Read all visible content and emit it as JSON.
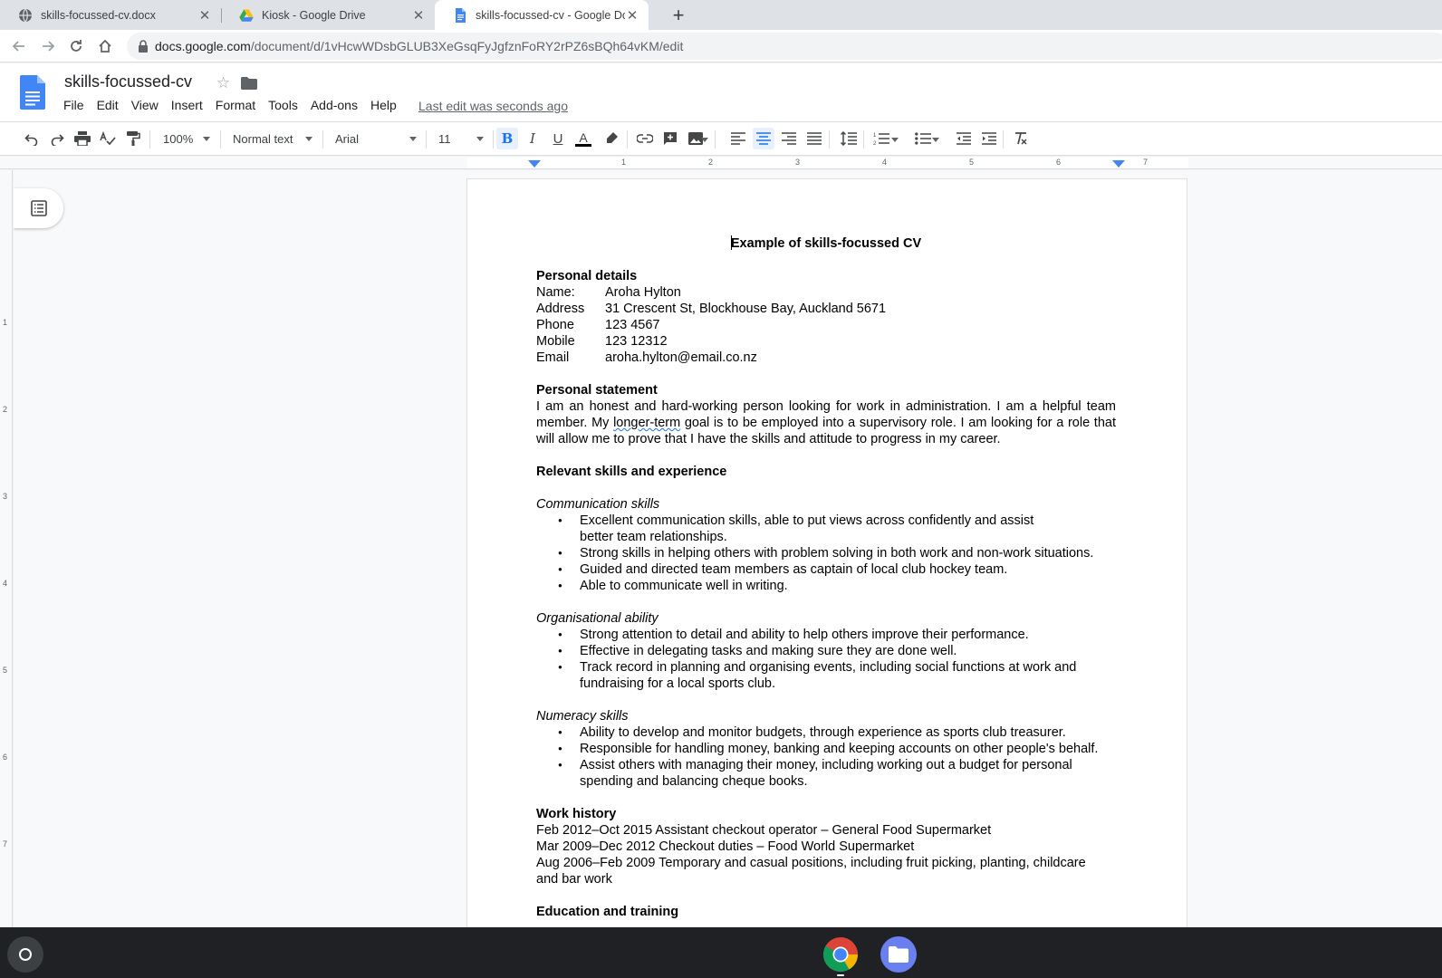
{
  "tabs": [
    {
      "label": "skills-focussed-cv.docx",
      "icon": "globe-icon"
    },
    {
      "label": "Kiosk - Google Drive",
      "icon": "drive-icon"
    },
    {
      "label": "skills-focussed-cv - Google Docs",
      "icon": "docs-icon"
    }
  ],
  "omnibox": {
    "host": "docs.google.com",
    "path": "/document/d/1vHcwWDsbGLUB3XeGsqFyJgfznFoRY2rPZ6sBQh64vKM/edit"
  },
  "header": {
    "title": "skills-focussed-cv",
    "menu": [
      "File",
      "Edit",
      "View",
      "Insert",
      "Format",
      "Tools",
      "Add-ons",
      "Help"
    ],
    "last_edit": "Last edit was seconds ago"
  },
  "toolbar": {
    "zoom": "100%",
    "style": "Normal text",
    "font": "Arial",
    "size": "11"
  },
  "ruler": {
    "h": [
      "1",
      "2",
      "3",
      "4",
      "5",
      "6",
      "7"
    ],
    "v": [
      "1",
      "2",
      "3",
      "4",
      "5",
      "6",
      "7"
    ]
  },
  "colors": {
    "accent": "#1a73e8",
    "docs_blue": "#4285f4",
    "text_color_bar": "#000000"
  },
  "doc": {
    "title": "Example of skills-focussed CV",
    "personal": {
      "heading": "Personal details",
      "rows": [
        {
          "k": "Name:",
          "v": "Aroha Hylton"
        },
        {
          "k": "Address",
          "v": "31 Crescent St, Blockhouse Bay, Auckland 5671"
        },
        {
          "k": "Phone",
          "v": "123 4567"
        },
        {
          "k": "Mobile",
          "v": "123 12312"
        },
        {
          "k": "Email",
          "v": "aroha.hylton@email.co.nz"
        }
      ]
    },
    "statement": {
      "heading": "Personal statement",
      "before": "I am an honest and hard-working person looking for work in administration. I am a helpful team member. My ",
      "flagged": "longer-term",
      "after": " goal is to be employed into a supervisory role. I am looking for a role that will allow me to prove that I have the skills and attitude to progress in my career."
    },
    "skills_heading": "Relevant skills and experience",
    "communication": {
      "heading": "Communication skills",
      "items": [
        "Excellent communication skills, able to put views across confidently and assist better team relationships.",
        "Strong skills in helping others with problem solving in both work and non-work situations.",
        "Guided and directed team members as captain of local club hockey team.",
        "Able to communicate well in writing."
      ]
    },
    "organisational": {
      "heading": "Organisational ability",
      "items": [
        "Strong attention to detail and ability to help others improve their performance.",
        "Effective in delegating tasks and making sure they are done well.",
        "Track record in planning and organising events, including social functions at work and fundraising for a local sports club."
      ]
    },
    "numeracy": {
      "heading": "Numeracy skills",
      "items": [
        "Ability to develop and monitor budgets, through experience as sports club treasurer.",
        "Responsible for handling money, banking and keeping accounts on other people's behalf.",
        "Assist others with managing their money, including working out a budget for personal spending and balancing cheque books."
      ]
    },
    "work": {
      "heading": "Work history",
      "lines": [
        "Feb 2012–Oct 2015 Assistant checkout operator – General Food Supermarket",
        "Mar 2009–Dec 2012 Checkout duties – Food World Supermarket",
        "Aug 2006–Feb 2009 Temporary and casual positions, including fruit picking, planting, childcare and bar work"
      ]
    },
    "education_heading": "Education and training"
  }
}
